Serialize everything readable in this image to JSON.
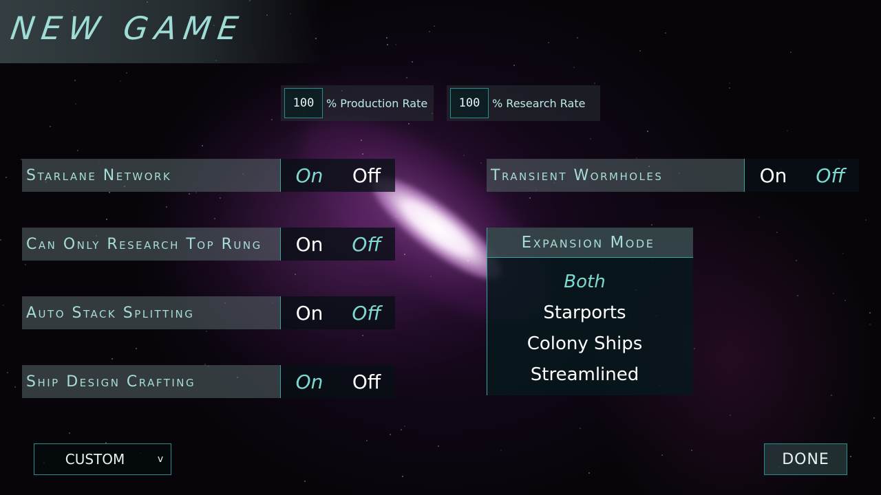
{
  "title": "NEW GAME",
  "rates": {
    "production": {
      "value": "100",
      "label": "% Production Rate"
    },
    "research": {
      "value": "100",
      "label": "% Research Rate"
    }
  },
  "toggles": {
    "starlane_network": {
      "label": "Starlane Network",
      "on": "On",
      "off": "Off",
      "selected": "On"
    },
    "research_top_rung": {
      "label": "Can Only Research Top Rung",
      "on": "On",
      "off": "Off",
      "selected": "Off"
    },
    "auto_stack_splitting": {
      "label": "Auto Stack Splitting",
      "on": "On",
      "off": "Off",
      "selected": "Off"
    },
    "ship_design_crafting": {
      "label": "Ship Design Crafting",
      "on": "On",
      "off": "Off",
      "selected": "On"
    },
    "transient_wormholes": {
      "label": "Transient Wormholes",
      "on": "On",
      "off": "Off",
      "selected": "Off"
    }
  },
  "expansion_mode": {
    "header": "Expansion Mode",
    "options": [
      "Both",
      "Starports",
      "Colony Ships",
      "Streamlined"
    ],
    "selected": "Both"
  },
  "preset": {
    "value": "CUSTOM",
    "chevron": "v"
  },
  "done_label": "DONE",
  "colors": {
    "accent": "#3aa6a2",
    "selected_text": "#7fd9d3",
    "label_text": "#a8ddd8"
  }
}
